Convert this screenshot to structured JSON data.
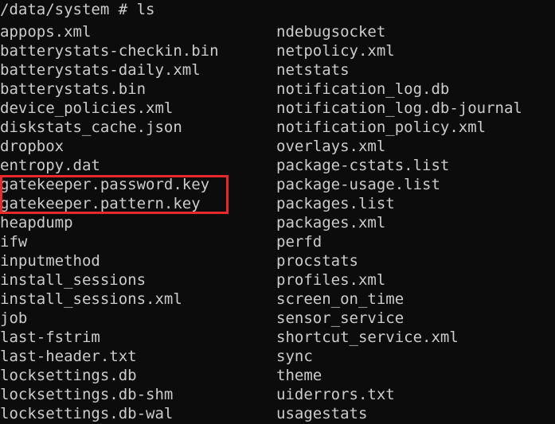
{
  "terminal": {
    "prompt": "/data/system # ls",
    "highlight_color": "#e8282b",
    "rows": [
      {
        "left": "appops.xml",
        "right": "ndebugsocket"
      },
      {
        "left": "batterystats-checkin.bin",
        "right": "netpolicy.xml"
      },
      {
        "left": "batterystats-daily.xml",
        "right": "netstats"
      },
      {
        "left": "batterystats.bin",
        "right": "notification_log.db"
      },
      {
        "left": "device_policies.xml",
        "right": "notification_log.db-journal"
      },
      {
        "left": "diskstats_cache.json",
        "right": "notification_policy.xml"
      },
      {
        "left": "dropbox",
        "right": "overlays.xml"
      },
      {
        "left": "entropy.dat",
        "right": "package-cstats.list"
      },
      {
        "left": "gatekeeper.password.key",
        "right": "package-usage.list"
      },
      {
        "left": "gatekeeper.pattern.key",
        "right": "packages.list"
      },
      {
        "left": "heapdump",
        "right": "packages.xml"
      },
      {
        "left": "ifw",
        "right": "perfd"
      },
      {
        "left": "inputmethod",
        "right": "procstats"
      },
      {
        "left": "install_sessions",
        "right": "profiles.xml"
      },
      {
        "left": "install_sessions.xml",
        "right": "screen_on_time"
      },
      {
        "left": "job",
        "right": "sensor_service"
      },
      {
        "left": "last-fstrim",
        "right": "shortcut_service.xml"
      },
      {
        "left": "last-header.txt",
        "right": "sync"
      },
      {
        "left": "locksettings.db",
        "right": "theme"
      },
      {
        "left": "locksettings.db-shm",
        "right": "uiderrors.txt"
      },
      {
        "left": "locksettings.db-wal",
        "right": "usagestats"
      }
    ]
  }
}
